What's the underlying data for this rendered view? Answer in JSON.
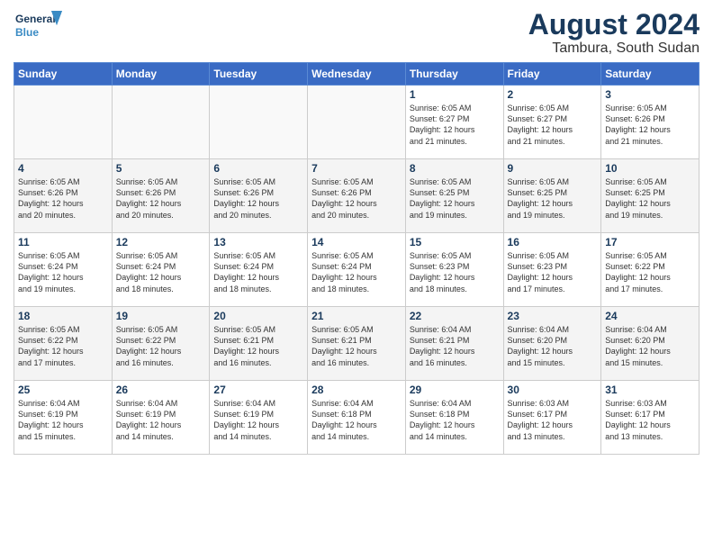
{
  "logo": {
    "line1": "General",
    "line2": "Blue"
  },
  "title": "August 2024",
  "location": "Tambura, South Sudan",
  "weekdays": [
    "Sunday",
    "Monday",
    "Tuesday",
    "Wednesday",
    "Thursday",
    "Friday",
    "Saturday"
  ],
  "weeks": [
    [
      {
        "day": "",
        "detail": ""
      },
      {
        "day": "",
        "detail": ""
      },
      {
        "day": "",
        "detail": ""
      },
      {
        "day": "",
        "detail": ""
      },
      {
        "day": "1",
        "detail": "Sunrise: 6:05 AM\nSunset: 6:27 PM\nDaylight: 12 hours\nand 21 minutes."
      },
      {
        "day": "2",
        "detail": "Sunrise: 6:05 AM\nSunset: 6:27 PM\nDaylight: 12 hours\nand 21 minutes."
      },
      {
        "day": "3",
        "detail": "Sunrise: 6:05 AM\nSunset: 6:26 PM\nDaylight: 12 hours\nand 21 minutes."
      }
    ],
    [
      {
        "day": "4",
        "detail": "Sunrise: 6:05 AM\nSunset: 6:26 PM\nDaylight: 12 hours\nand 20 minutes."
      },
      {
        "day": "5",
        "detail": "Sunrise: 6:05 AM\nSunset: 6:26 PM\nDaylight: 12 hours\nand 20 minutes."
      },
      {
        "day": "6",
        "detail": "Sunrise: 6:05 AM\nSunset: 6:26 PM\nDaylight: 12 hours\nand 20 minutes."
      },
      {
        "day": "7",
        "detail": "Sunrise: 6:05 AM\nSunset: 6:26 PM\nDaylight: 12 hours\nand 20 minutes."
      },
      {
        "day": "8",
        "detail": "Sunrise: 6:05 AM\nSunset: 6:25 PM\nDaylight: 12 hours\nand 19 minutes."
      },
      {
        "day": "9",
        "detail": "Sunrise: 6:05 AM\nSunset: 6:25 PM\nDaylight: 12 hours\nand 19 minutes."
      },
      {
        "day": "10",
        "detail": "Sunrise: 6:05 AM\nSunset: 6:25 PM\nDaylight: 12 hours\nand 19 minutes."
      }
    ],
    [
      {
        "day": "11",
        "detail": "Sunrise: 6:05 AM\nSunset: 6:24 PM\nDaylight: 12 hours\nand 19 minutes."
      },
      {
        "day": "12",
        "detail": "Sunrise: 6:05 AM\nSunset: 6:24 PM\nDaylight: 12 hours\nand 18 minutes."
      },
      {
        "day": "13",
        "detail": "Sunrise: 6:05 AM\nSunset: 6:24 PM\nDaylight: 12 hours\nand 18 minutes."
      },
      {
        "day": "14",
        "detail": "Sunrise: 6:05 AM\nSunset: 6:24 PM\nDaylight: 12 hours\nand 18 minutes."
      },
      {
        "day": "15",
        "detail": "Sunrise: 6:05 AM\nSunset: 6:23 PM\nDaylight: 12 hours\nand 18 minutes."
      },
      {
        "day": "16",
        "detail": "Sunrise: 6:05 AM\nSunset: 6:23 PM\nDaylight: 12 hours\nand 17 minutes."
      },
      {
        "day": "17",
        "detail": "Sunrise: 6:05 AM\nSunset: 6:22 PM\nDaylight: 12 hours\nand 17 minutes."
      }
    ],
    [
      {
        "day": "18",
        "detail": "Sunrise: 6:05 AM\nSunset: 6:22 PM\nDaylight: 12 hours\nand 17 minutes."
      },
      {
        "day": "19",
        "detail": "Sunrise: 6:05 AM\nSunset: 6:22 PM\nDaylight: 12 hours\nand 16 minutes."
      },
      {
        "day": "20",
        "detail": "Sunrise: 6:05 AM\nSunset: 6:21 PM\nDaylight: 12 hours\nand 16 minutes."
      },
      {
        "day": "21",
        "detail": "Sunrise: 6:05 AM\nSunset: 6:21 PM\nDaylight: 12 hours\nand 16 minutes."
      },
      {
        "day": "22",
        "detail": "Sunrise: 6:04 AM\nSunset: 6:21 PM\nDaylight: 12 hours\nand 16 minutes."
      },
      {
        "day": "23",
        "detail": "Sunrise: 6:04 AM\nSunset: 6:20 PM\nDaylight: 12 hours\nand 15 minutes."
      },
      {
        "day": "24",
        "detail": "Sunrise: 6:04 AM\nSunset: 6:20 PM\nDaylight: 12 hours\nand 15 minutes."
      }
    ],
    [
      {
        "day": "25",
        "detail": "Sunrise: 6:04 AM\nSunset: 6:19 PM\nDaylight: 12 hours\nand 15 minutes."
      },
      {
        "day": "26",
        "detail": "Sunrise: 6:04 AM\nSunset: 6:19 PM\nDaylight: 12 hours\nand 14 minutes."
      },
      {
        "day": "27",
        "detail": "Sunrise: 6:04 AM\nSunset: 6:19 PM\nDaylight: 12 hours\nand 14 minutes."
      },
      {
        "day": "28",
        "detail": "Sunrise: 6:04 AM\nSunset: 6:18 PM\nDaylight: 12 hours\nand 14 minutes."
      },
      {
        "day": "29",
        "detail": "Sunrise: 6:04 AM\nSunset: 6:18 PM\nDaylight: 12 hours\nand 14 minutes."
      },
      {
        "day": "30",
        "detail": "Sunrise: 6:03 AM\nSunset: 6:17 PM\nDaylight: 12 hours\nand 13 minutes."
      },
      {
        "day": "31",
        "detail": "Sunrise: 6:03 AM\nSunset: 6:17 PM\nDaylight: 12 hours\nand 13 minutes."
      }
    ]
  ]
}
